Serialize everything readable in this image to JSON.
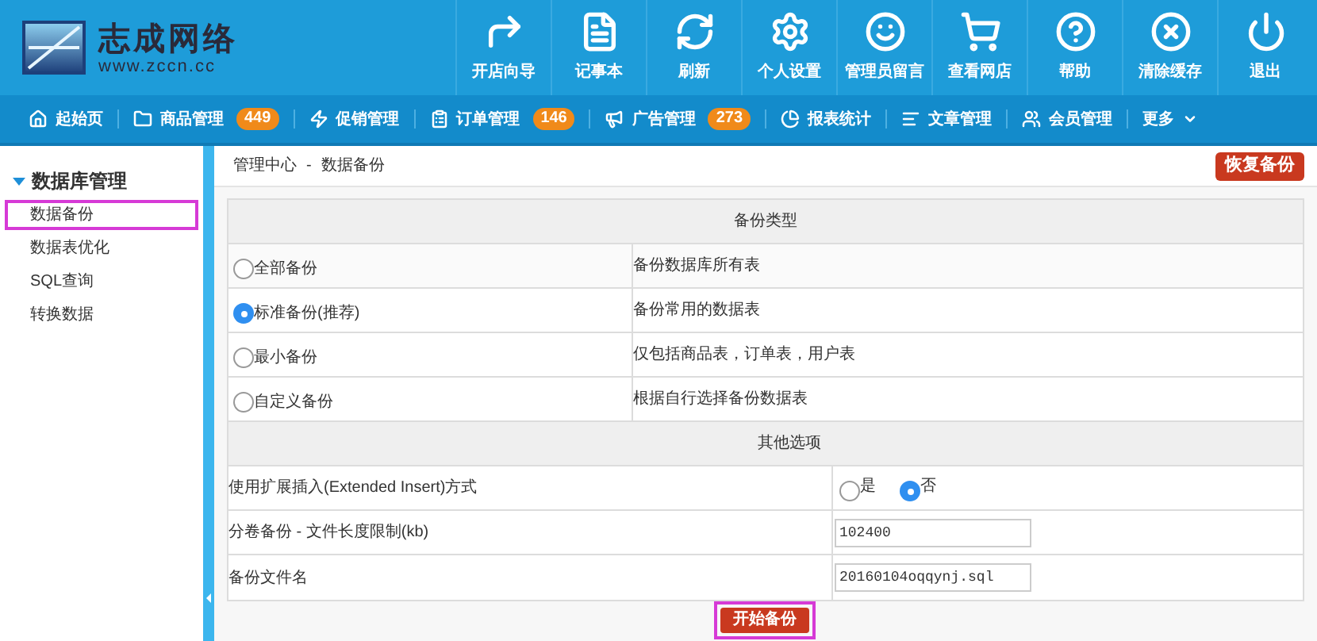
{
  "logo": {
    "name": "志成网络",
    "url": "www.zccn.cc"
  },
  "toolbar": [
    {
      "label": "开店向导"
    },
    {
      "label": "记事本"
    },
    {
      "label": "刷新"
    },
    {
      "label": "个人设置"
    },
    {
      "label": "管理员留言"
    },
    {
      "label": "查看网店"
    },
    {
      "label": "帮助"
    },
    {
      "label": "清除缓存"
    },
    {
      "label": "退出"
    }
  ],
  "nav": [
    {
      "label": "起始页"
    },
    {
      "label": "商品管理",
      "badge": "449"
    },
    {
      "label": "促销管理"
    },
    {
      "label": "订单管理",
      "badge": "146"
    },
    {
      "label": "广告管理",
      "badge": "273"
    },
    {
      "label": "报表统计"
    },
    {
      "label": "文章管理"
    },
    {
      "label": "会员管理"
    },
    {
      "label": "更多",
      "kind": "menu"
    }
  ],
  "sidebar": {
    "title": "数据库管理",
    "expanded": true,
    "items": [
      {
        "label": "数据备份",
        "selected": true
      },
      {
        "label": "数据表优化",
        "selected": false
      },
      {
        "label": "SQL查询",
        "selected": false
      },
      {
        "label": "转换数据",
        "selected": false
      }
    ]
  },
  "breadcrumb": [
    "管理中心",
    "-",
    "数据备份"
  ],
  "restore_button": "恢复备份",
  "backup_type": {
    "heading": "备份类型",
    "options": [
      {
        "label": "全部备份",
        "description": "备份数据库所有表",
        "selected": false
      },
      {
        "label": "标准备份(推荐)",
        "description": "备份常用的数据表",
        "selected": true
      },
      {
        "label": "最小备份",
        "description": "仅包括商品表，订单表，用户表",
        "selected": false
      },
      {
        "label": "自定义备份",
        "description": "根据自行选择备份数据表",
        "selected": false
      }
    ]
  },
  "other_options": {
    "heading": "其他选项",
    "rows": [
      {
        "kind": "radio",
        "label": "使用扩展插入(Extended Insert)方式",
        "choices": [
          {
            "label": "是",
            "selected": false
          },
          {
            "label": "否",
            "selected": true
          }
        ]
      },
      {
        "kind": "input",
        "label": "分卷备份 - 文件长度限制(kb)",
        "value": "102400"
      },
      {
        "kind": "input",
        "label": "备份文件名",
        "value": "20160104oqqynj.sql"
      }
    ]
  },
  "start_button": {
    "label": "开始备份",
    "highlighted": true
  }
}
